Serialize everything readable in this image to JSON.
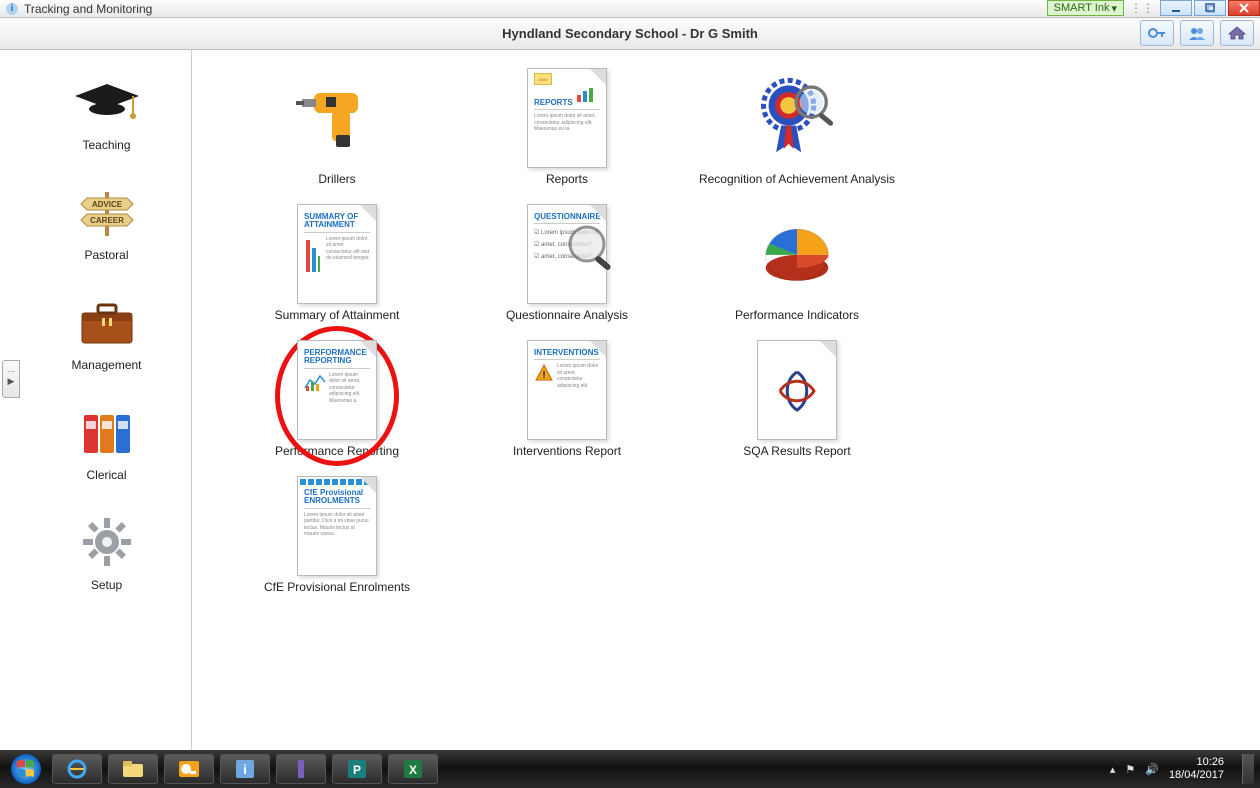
{
  "titlebar": {
    "title": "Tracking and Monitoring",
    "smart_ink": "SMART Ink"
  },
  "header": {
    "title": "Hyndland Secondary School - Dr G Smith"
  },
  "sidebar": {
    "items": [
      {
        "label": "Teaching",
        "icon": "mortarboard"
      },
      {
        "label": "Pastoral",
        "icon": "signpost"
      },
      {
        "label": "Management",
        "icon": "briefcase"
      },
      {
        "label": "Clerical",
        "icon": "binders"
      },
      {
        "label": "Setup",
        "icon": "gear"
      }
    ]
  },
  "content": {
    "cards": [
      {
        "label": "Drillers",
        "kind": "drill"
      },
      {
        "label": "Reports",
        "kind": "doc",
        "doc_title": "REPORTS"
      },
      {
        "label": "Recognition of Achievement Analysis",
        "kind": "rosette"
      },
      {
        "label": "Summary of Attainment",
        "kind": "doc",
        "doc_title": "SUMMARY OF ATTAINMENT"
      },
      {
        "label": "Questionnaire Analysis",
        "kind": "doc-mag",
        "doc_title": "QUESTIONNAIRE"
      },
      {
        "label": "Performance Indicators",
        "kind": "piechart"
      },
      {
        "label": "Performance Reporting",
        "kind": "doc",
        "doc_title": "PERFORMANCE REPORTING",
        "highlighted": true
      },
      {
        "label": "Interventions Report",
        "kind": "doc-warn",
        "doc_title": "INTERVENTIONS"
      },
      {
        "label": "SQA Results Report",
        "kind": "sqa"
      },
      {
        "label": "CfE Provisional Enrolments",
        "kind": "doc",
        "doc_title": "CfE Provisional ENROLMENTS"
      }
    ]
  },
  "taskbar": {
    "time": "10:26",
    "date": "18/04/2017"
  }
}
